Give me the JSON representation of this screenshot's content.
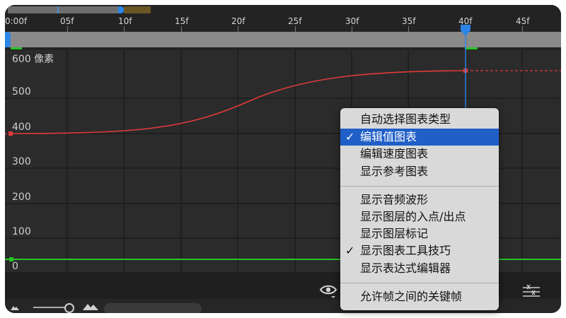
{
  "ruler": {
    "labels": [
      "0:00f",
      "05f",
      "10f",
      "15f",
      "20f",
      "25f",
      "30f",
      "35f",
      "40f",
      "45f"
    ]
  },
  "graph": {
    "y_labels": [
      "600 像素",
      "500",
      "400",
      "300",
      "200",
      "100",
      "0"
    ],
    "curve_color": "#e03b3b",
    "baseline_color": "#27c427",
    "current_time_color": "#2b86e8"
  },
  "menu": {
    "items": [
      {
        "label": "自动选择图表类型",
        "checked": false,
        "selected": false
      },
      {
        "label": "编辑值图表",
        "checked": true,
        "selected": true
      },
      {
        "label": "编辑速度图表",
        "checked": false,
        "selected": false
      },
      {
        "label": "显示参考图表",
        "checked": false,
        "selected": false
      },
      {
        "label": "显示音频波形",
        "checked": false,
        "selected": false
      },
      {
        "label": "显示图层的入点/出点",
        "checked": false,
        "selected": false
      },
      {
        "label": "显示图层标记",
        "checked": false,
        "selected": false
      },
      {
        "label": "显示图表工具技巧",
        "checked": true,
        "selected": false
      },
      {
        "label": "显示表达式编辑器",
        "checked": false,
        "selected": false
      },
      {
        "label": "允许帧之间的关键帧",
        "checked": false,
        "selected": false
      }
    ],
    "check_glyph": "✓"
  },
  "bottom_bar": {
    "icons": [
      "eye-icon",
      "anchor-snap-icon",
      "zoom-out-mountain-icon",
      "zoom-in-mountain-icon"
    ]
  },
  "colors": {
    "accent": "#2b86e8",
    "menu_highlight": "#1f5fc7",
    "panel_bg": "#2b2b2b"
  }
}
